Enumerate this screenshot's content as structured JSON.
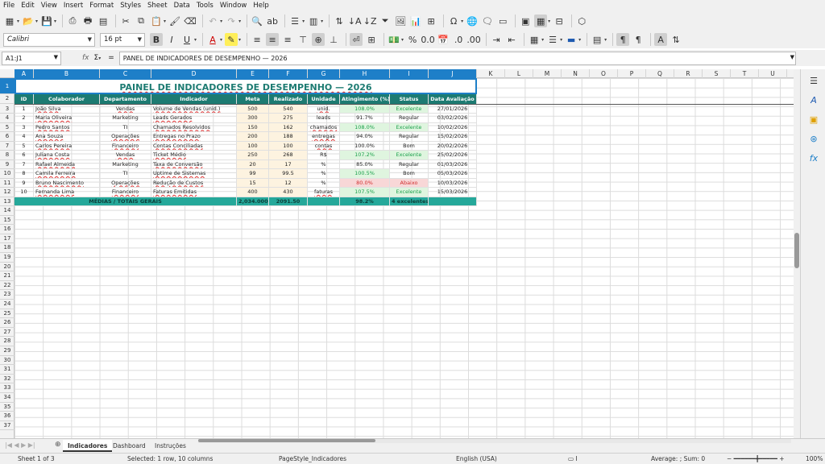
{
  "menu": [
    "File",
    "Edit",
    "View",
    "Insert",
    "Format",
    "Styles",
    "Sheet",
    "Data",
    "Tools",
    "Window",
    "Help"
  ],
  "font": {
    "name": "Calibri",
    "size": "16 pt"
  },
  "name_box": "A1:J1",
  "formula": "PANEL DE INDICADORES DE DESEMPENHO — 2026",
  "formula_icons": {
    "fx": "fx",
    "sum": "Σ",
    "eq": "="
  },
  "columns": [
    "A",
    "B",
    "C",
    "D",
    "E",
    "F",
    "G",
    "H",
    "I",
    "J",
    "K",
    "L",
    "M",
    "N",
    "O",
    "P",
    "Q",
    "R",
    "S",
    "T",
    "U"
  ],
  "rows": [
    "1",
    "2",
    "3",
    "4",
    "5",
    "6",
    "7",
    "8",
    "9",
    "10",
    "11",
    "12",
    "13",
    "14",
    "15",
    "16",
    "17",
    "18",
    "19",
    "20",
    "21",
    "22",
    "23",
    "24",
    "25",
    "26",
    "27",
    "28",
    "29",
    "30",
    "31",
    "32",
    "33",
    "34",
    "35",
    "36",
    "37"
  ],
  "title": "PAINEL DE INDICADORES DE DESEMPENHO — 2026",
  "headers": [
    "ID",
    "Colaborador",
    "Departamento",
    "Indicador",
    "Meta",
    "Realizado",
    "Unidade",
    "Atingimento (%)",
    "Status",
    "Data Avaliação"
  ],
  "data": [
    [
      "1",
      "João Silva",
      "Vendas",
      "Volume de Vendas (unid.)",
      "500",
      "540",
      "unid.",
      "108.0%",
      "Excelente",
      "27/01/2026"
    ],
    [
      "2",
      "Maria Oliveira",
      "Marketing",
      "Leads Gerados",
      "300",
      "275",
      "leads",
      "91.7%",
      "Regular",
      "03/02/2026"
    ],
    [
      "3",
      "Pedro Santos",
      "TI",
      "Chamados Resolvidos",
      "150",
      "162",
      "chamados",
      "108.0%",
      "Excelente",
      "10/02/2026"
    ],
    [
      "4",
      "Ana Souza",
      "Operações",
      "Entregas no Prazo",
      "200",
      "188",
      "entregas",
      "94.0%",
      "Regular",
      "15/02/2026"
    ],
    [
      "5",
      "Carlos Pereira",
      "Financeiro",
      "Contas Conciliadas",
      "100",
      "100",
      "contas",
      "100.0%",
      "Bom",
      "20/02/2026"
    ],
    [
      "6",
      "Juliana Costa",
      "Vendas",
      "Ticket Médio",
      "250",
      "268",
      "R$",
      "107.2%",
      "Excelente",
      "25/02/2026"
    ],
    [
      "7",
      "Rafael Almeida",
      "Marketing",
      "Taxa de Conversão",
      "20",
      "17",
      "%",
      "85.0%",
      "Regular",
      "01/03/2026"
    ],
    [
      "8",
      "Camila Ferreira",
      "TI",
      "Uptime de Sistemas",
      "99",
      "99.5",
      "%",
      "100.5%",
      "Bom",
      "05/03/2026"
    ],
    [
      "9",
      "Bruno Nascimento",
      "Operações",
      "Redução de Custos",
      "15",
      "12",
      "%",
      "80.0%",
      "Abaixo",
      "10/03/2026"
    ],
    [
      "10",
      "Fernanda Lima",
      "Financeiro",
      "Faturas Emitidas",
      "400",
      "430",
      "faturas",
      "107.5%",
      "Excelente",
      "15/03/2026"
    ]
  ],
  "totals": {
    "label": "MÉDIAS / TOTAIS GERAIS",
    "meta": "2,034.00000",
    "realizado": "2091.50",
    "ating": "98.2%",
    "status": "4 excelentes"
  },
  "tabs": [
    "Indicadores",
    "Dashboard",
    "Instruções"
  ],
  "status": {
    "sheet": "Sheet 1 of 3",
    "selected": "Selected: 1 row, 10 columns",
    "pagestyle": "PageStyle_Indicadores",
    "lang": "English (USA)",
    "calc": "Average: ; Sum: 0",
    "zoom": "100%"
  },
  "colors": {
    "header": "#1d7b72",
    "total": "#25a89a",
    "title": "#1d7b72",
    "excelente_bg": "#dff5df",
    "excelente_fg": "#1aa04a",
    "abaixo_bg": "#f8d7d7",
    "abaixo_fg": "#d03030",
    "selection": "#1e7fc8"
  }
}
